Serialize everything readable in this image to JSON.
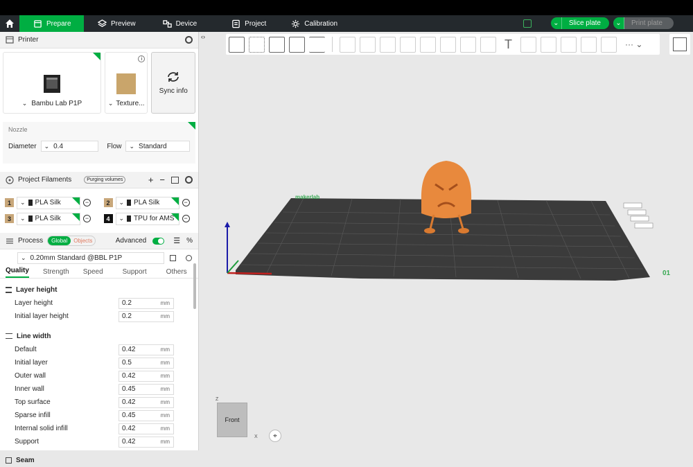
{
  "tabs": {
    "prepare": "Prepare",
    "preview": "Preview",
    "device": "Device",
    "project": "Project",
    "calibration": "Calibration"
  },
  "actions": {
    "slice": "Slice plate",
    "print": "Print plate"
  },
  "printer": {
    "section_title": "Printer",
    "name": "Bambu Lab P1P",
    "plate": "Texture...",
    "sync": "Sync info",
    "nozzle_label": "Nozzle",
    "diameter_label": "Diameter",
    "diameter_value": "0.4",
    "flow_label": "Flow",
    "flow_value": "Standard"
  },
  "filaments": {
    "section_title": "Project Filaments",
    "purging": "Purging volumes",
    "items": [
      {
        "num": "1",
        "name": "PLA Silk",
        "color": "#c8a77a"
      },
      {
        "num": "2",
        "name": "PLA Silk",
        "color": "#c8a77a"
      },
      {
        "num": "3",
        "name": "PLA Silk",
        "color": "#c8a77a"
      },
      {
        "num": "4",
        "name": "TPU for AMS",
        "color": "#111111"
      }
    ]
  },
  "process": {
    "section_title": "Process",
    "global": "Global",
    "objects": "Objects",
    "advanced": "Advanced",
    "preset": "0.20mm Standard @BBL P1P",
    "subtabs": [
      "Quality",
      "Strength",
      "Speed",
      "Support",
      "Others"
    ],
    "layer_group": "Layer height",
    "layer_rows": [
      {
        "label": "Layer height",
        "value": "0.2",
        "unit": "mm"
      },
      {
        "label": "Initial layer height",
        "value": "0.2",
        "unit": "mm"
      }
    ],
    "line_group": "Line width",
    "line_rows": [
      {
        "label": "Default",
        "value": "0.42",
        "unit": "mm"
      },
      {
        "label": "Initial layer",
        "value": "0.5",
        "unit": "mm"
      },
      {
        "label": "Outer wall",
        "value": "0.42",
        "unit": "mm"
      },
      {
        "label": "Inner wall",
        "value": "0.45",
        "unit": "mm"
      },
      {
        "label": "Top surface",
        "value": "0.42",
        "unit": "mm"
      },
      {
        "label": "Sparse infill",
        "value": "0.45",
        "unit": "mm"
      },
      {
        "label": "Internal solid infill",
        "value": "0.42",
        "unit": "mm"
      },
      {
        "label": "Support",
        "value": "0.42",
        "unit": "mm"
      }
    ],
    "seam_group": "Seam"
  },
  "viewport": {
    "cube_label": "Front",
    "plate_brand": "makerlab",
    "plate_number": "01",
    "axis_z": "Z",
    "axis_x": "X"
  },
  "colors": {
    "accent": "#00ae42",
    "model": "#e8893d",
    "bed": "#3b3b3b"
  }
}
